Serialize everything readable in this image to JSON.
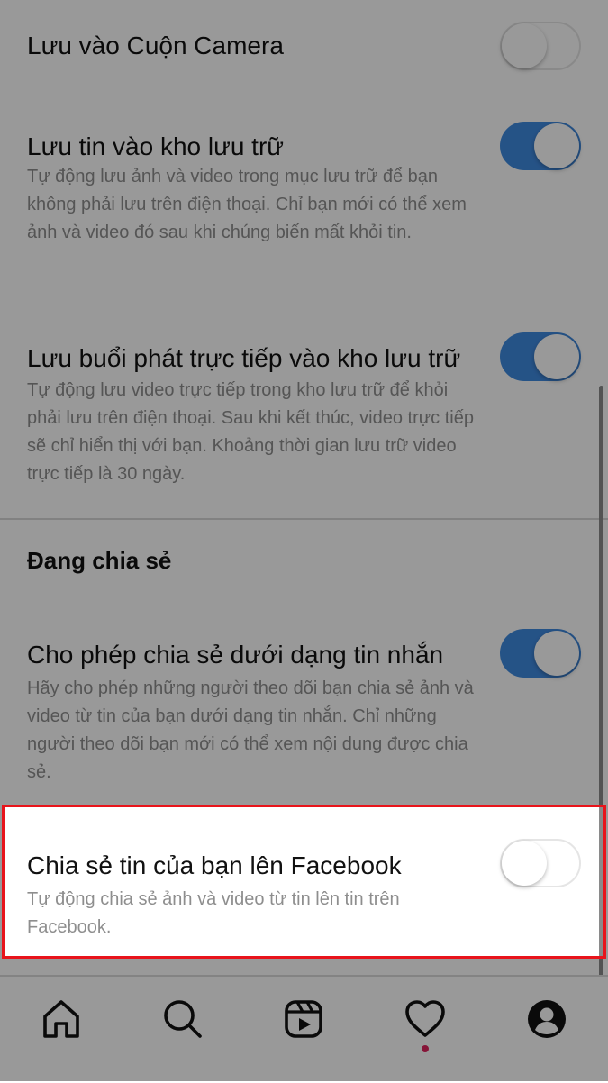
{
  "colors": {
    "toggle_on": "#3f8ae0",
    "highlight_border": "#e8141b",
    "notification_dot": "#e0245e",
    "secondary_text": "#8e8e8e"
  },
  "settings": {
    "save_camera_roll": {
      "title": "Lưu vào Cuộn Camera",
      "enabled": false
    },
    "save_story_archive": {
      "title": "Lưu tin vào kho lưu trữ",
      "description": "Tự động lưu ảnh và video trong mục lưu trữ để bạn không phải lưu trên điện thoại. Chỉ bạn mới có thể xem ảnh và video đó sau khi chúng biến mất khỏi tin.",
      "enabled": true
    },
    "save_live_archive": {
      "title": "Lưu buổi phát trực tiếp vào kho lưu trữ",
      "description": "Tự động lưu video trực tiếp trong kho lưu trữ để khỏi phải lưu trên điện thoại. Sau khi kết thúc, video trực tiếp sẽ chỉ hiển thị với bạn. Khoảng thời gian lưu trữ video trực tiếp là 30 ngày.",
      "enabled": true
    }
  },
  "sharing": {
    "section_title": "Đang chia sẻ",
    "allow_message_sharing": {
      "title": "Cho phép chia sẻ dưới dạng tin nhắn",
      "description": "Hãy cho phép những người theo dõi bạn chia sẻ ảnh và video từ tin của bạn dưới dạng tin nhắn. Chỉ những người theo dõi bạn mới có thể xem nội dung được chia sẻ.",
      "enabled": true
    },
    "share_to_facebook": {
      "title": "Chia sẻ tin của bạn lên Facebook",
      "description": "Tự động chia sẻ ảnh và video từ tin lên tin trên Facebook.",
      "enabled": false
    }
  },
  "tabbar": {
    "tabs": [
      {
        "icon": "home-icon"
      },
      {
        "icon": "search-icon"
      },
      {
        "icon": "reels-icon"
      },
      {
        "icon": "heart-icon",
        "has_notification": true
      },
      {
        "icon": "profile-icon"
      }
    ]
  }
}
